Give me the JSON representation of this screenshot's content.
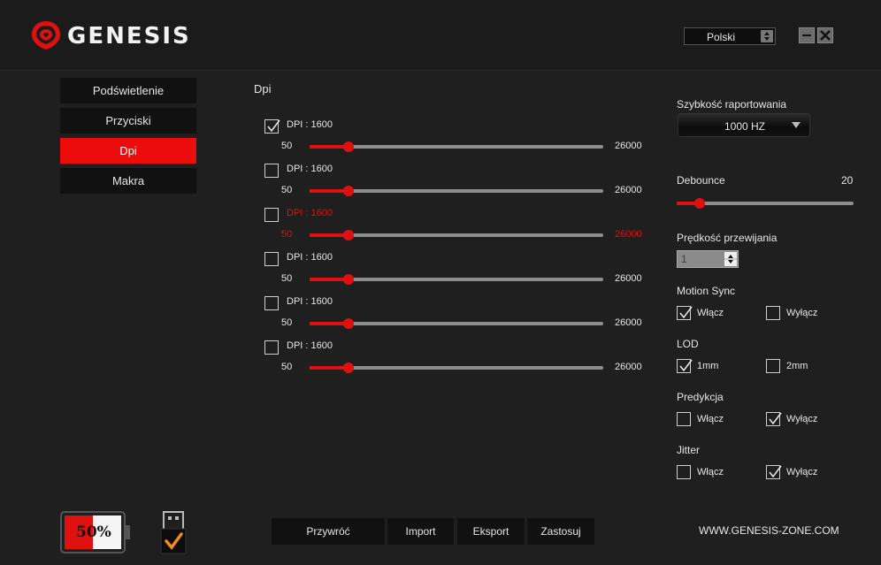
{
  "header": {
    "brand": "GENESIS",
    "language": "Polski",
    "accent_color": "#e01010"
  },
  "nav": {
    "items": [
      {
        "label": "Podświetlenie",
        "active": false
      },
      {
        "label": "Przyciski",
        "active": false
      },
      {
        "label": "Dpi",
        "active": true
      },
      {
        "label": "Makra",
        "active": false
      }
    ]
  },
  "dpi": {
    "title": "Dpi",
    "levels": [
      {
        "label": "DPI : 1600",
        "checked": true,
        "min": "50",
        "max": "26000",
        "value": 1600,
        "highlight": false
      },
      {
        "label": "DPI : 1600",
        "checked": false,
        "min": "50",
        "max": "26000",
        "value": 1600,
        "highlight": false
      },
      {
        "label": "DPI : 1600",
        "checked": false,
        "min": "50",
        "max": "26000",
        "value": 1600,
        "highlight": true
      },
      {
        "label": "DPI : 1600",
        "checked": false,
        "min": "50",
        "max": "26000",
        "value": 1600,
        "highlight": false
      },
      {
        "label": "DPI : 1600",
        "checked": false,
        "min": "50",
        "max": "26000",
        "value": 1600,
        "highlight": false
      },
      {
        "label": "DPI : 1600",
        "checked": false,
        "min": "50",
        "max": "26000",
        "value": 1600,
        "highlight": false
      }
    ]
  },
  "settings": {
    "report_rate": {
      "label": "Szybkość raportowania",
      "value": "1000 HZ"
    },
    "debounce": {
      "label": "Debounce",
      "value": "20",
      "fraction": 0.1
    },
    "scroll_speed": {
      "label": "Prędkość przewijania",
      "value": "1"
    },
    "motion_sync": {
      "label": "Motion Sync",
      "opt_a": "Włącz",
      "opt_b": "Wyłącz",
      "selected": "a"
    },
    "lod": {
      "label": "LOD",
      "opt_a": "1mm",
      "opt_b": "2mm",
      "selected": "a"
    },
    "prediction": {
      "label": "Predykcja",
      "opt_a": "Włącz",
      "opt_b": "Wyłącz",
      "selected": "b"
    },
    "jitter": {
      "label": "Jitter",
      "opt_a": "Włącz",
      "opt_b": "Wyłącz",
      "selected": "b"
    }
  },
  "footer": {
    "battery_percent": "50%",
    "battery_fraction": 0.5,
    "buttons": {
      "restore": "Przywróć",
      "import": "Import",
      "export": "Eksport",
      "apply": "Zastosuj"
    },
    "website": "WWW.GENESIS-ZONE.COM"
  }
}
